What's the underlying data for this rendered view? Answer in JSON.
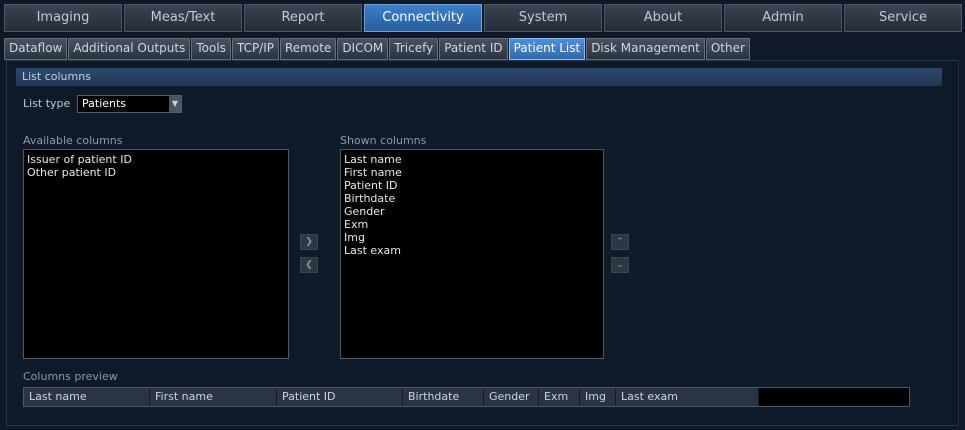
{
  "top_tabs": [
    {
      "label": "Imaging",
      "active": false
    },
    {
      "label": "Meas/Text",
      "active": false
    },
    {
      "label": "Report",
      "active": false
    },
    {
      "label": "Connectivity",
      "active": true
    },
    {
      "label": "System",
      "active": false
    },
    {
      "label": "About",
      "active": false
    },
    {
      "label": "Admin",
      "active": false
    },
    {
      "label": "Service",
      "active": false
    }
  ],
  "sub_tabs": [
    {
      "label": "Dataflow",
      "active": false
    },
    {
      "label": "Additional Outputs",
      "active": false
    },
    {
      "label": "Tools",
      "active": false
    },
    {
      "label": "TCP/IP",
      "active": false
    },
    {
      "label": "Remote",
      "active": false
    },
    {
      "label": "DICOM",
      "active": false
    },
    {
      "label": "Tricefy",
      "active": false
    },
    {
      "label": "Patient ID",
      "active": false
    },
    {
      "label": "Patient List",
      "active": true
    },
    {
      "label": "Disk Management",
      "active": false
    },
    {
      "label": "Other",
      "active": false
    }
  ],
  "panel": {
    "header": "List columns",
    "list_type_label": "List type",
    "list_type_value": "Patients",
    "available_label": "Available columns",
    "available_items": [
      "Issuer of patient ID",
      "Other patient ID"
    ],
    "shown_label": "Shown columns",
    "shown_items": [
      "Last name",
      "First name",
      "Patient ID",
      "Birthdate",
      "Gender",
      "Exm",
      "Img",
      "Last exam"
    ],
    "preview_label": "Columns preview",
    "preview_columns": [
      "Last name",
      "First name",
      "Patient ID",
      "Birthdate",
      "Gender",
      "Exm",
      "Img",
      "Last exam"
    ]
  },
  "icons": {
    "dropdown": "chevron-down-icon",
    "move_right": "chevron-right-icon",
    "move_left": "chevron-left-icon",
    "move_up": "chevron-up-icon",
    "move_down": "chevron-down-icon"
  },
  "colors": {
    "background": "#0e1826",
    "active_tab": "#3c7ec9",
    "panel_header": "#2d4a6e"
  }
}
